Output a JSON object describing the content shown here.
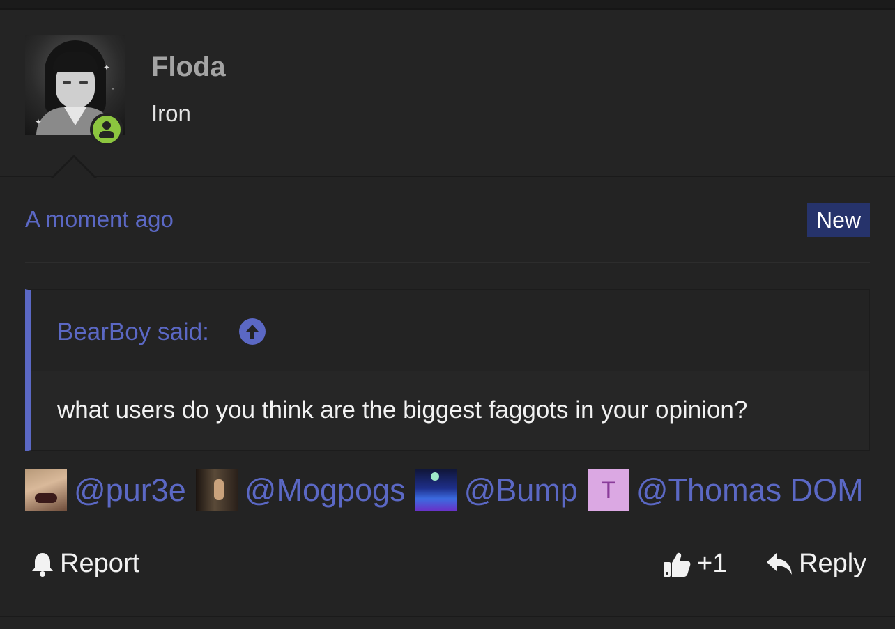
{
  "post": {
    "author": {
      "name": "Floda",
      "title": "Iron",
      "status": "online"
    },
    "timestamp": "A moment ago",
    "badge": "New",
    "quote": {
      "author_label": "BearBoy said:",
      "text": "what users do you think are the biggest faggots in your opinion?"
    },
    "mentions": [
      {
        "label": "@pur3e",
        "avatar": "photo"
      },
      {
        "label": "@Mogpogs",
        "avatar": "photo"
      },
      {
        "label": "@Bump",
        "avatar": "photo"
      },
      {
        "label": "@Thomas DOM",
        "avatar": "letter",
        "letter": "T"
      }
    ],
    "actions": {
      "report_label": "Report",
      "like_count": "+1",
      "reply_label": "Reply"
    }
  },
  "colors": {
    "background": "#232323",
    "accent": "#5b68c4",
    "badge_bg": "#26336b",
    "online": "#8cc63f",
    "letter_avatar_bg": "#dba8e3"
  },
  "icons": [
    "user-online-icon",
    "arrow-up-circle-icon",
    "bell-icon",
    "thumbs-up-icon",
    "reply-arrow-icon"
  ]
}
